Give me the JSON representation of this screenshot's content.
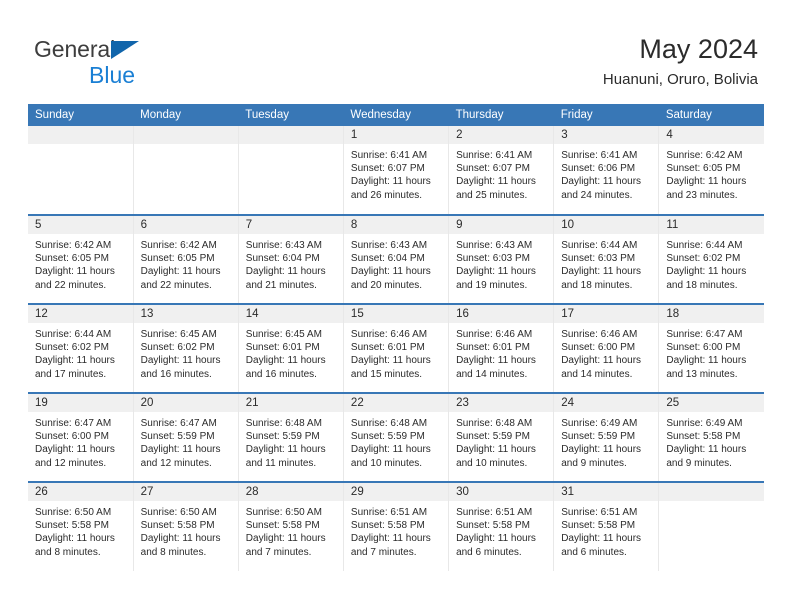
{
  "brand": {
    "name_top": "General",
    "name_bottom": "Blue",
    "triangle_color": "#1165ab",
    "blue_color": "#1a7fd4"
  },
  "header": {
    "title": "May 2024",
    "subtitle": "Huanuni, Oruro, Bolivia"
  },
  "theme": {
    "header_blue": "#3877b6",
    "daynum_band": "#f0f0f0",
    "text": "#2b2b2b"
  },
  "columns": [
    "Sunday",
    "Monday",
    "Tuesday",
    "Wednesday",
    "Thursday",
    "Friday",
    "Saturday"
  ],
  "weeks": [
    [
      {
        "day": "",
        "lines": []
      },
      {
        "day": "",
        "lines": []
      },
      {
        "day": "",
        "lines": []
      },
      {
        "day": "1",
        "lines": [
          "Sunrise: 6:41 AM",
          "Sunset: 6:07 PM",
          "Daylight: 11 hours",
          "and 26 minutes."
        ]
      },
      {
        "day": "2",
        "lines": [
          "Sunrise: 6:41 AM",
          "Sunset: 6:07 PM",
          "Daylight: 11 hours",
          "and 25 minutes."
        ]
      },
      {
        "day": "3",
        "lines": [
          "Sunrise: 6:41 AM",
          "Sunset: 6:06 PM",
          "Daylight: 11 hours",
          "and 24 minutes."
        ]
      },
      {
        "day": "4",
        "lines": [
          "Sunrise: 6:42 AM",
          "Sunset: 6:05 PM",
          "Daylight: 11 hours",
          "and 23 minutes."
        ]
      }
    ],
    [
      {
        "day": "5",
        "lines": [
          "Sunrise: 6:42 AM",
          "Sunset: 6:05 PM",
          "Daylight: 11 hours",
          "and 22 minutes."
        ]
      },
      {
        "day": "6",
        "lines": [
          "Sunrise: 6:42 AM",
          "Sunset: 6:05 PM",
          "Daylight: 11 hours",
          "and 22 minutes."
        ]
      },
      {
        "day": "7",
        "lines": [
          "Sunrise: 6:43 AM",
          "Sunset: 6:04 PM",
          "Daylight: 11 hours",
          "and 21 minutes."
        ]
      },
      {
        "day": "8",
        "lines": [
          "Sunrise: 6:43 AM",
          "Sunset: 6:04 PM",
          "Daylight: 11 hours",
          "and 20 minutes."
        ]
      },
      {
        "day": "9",
        "lines": [
          "Sunrise: 6:43 AM",
          "Sunset: 6:03 PM",
          "Daylight: 11 hours",
          "and 19 minutes."
        ]
      },
      {
        "day": "10",
        "lines": [
          "Sunrise: 6:44 AM",
          "Sunset: 6:03 PM",
          "Daylight: 11 hours",
          "and 18 minutes."
        ]
      },
      {
        "day": "11",
        "lines": [
          "Sunrise: 6:44 AM",
          "Sunset: 6:02 PM",
          "Daylight: 11 hours",
          "and 18 minutes."
        ]
      }
    ],
    [
      {
        "day": "12",
        "lines": [
          "Sunrise: 6:44 AM",
          "Sunset: 6:02 PM",
          "Daylight: 11 hours",
          "and 17 minutes."
        ]
      },
      {
        "day": "13",
        "lines": [
          "Sunrise: 6:45 AM",
          "Sunset: 6:02 PM",
          "Daylight: 11 hours",
          "and 16 minutes."
        ]
      },
      {
        "day": "14",
        "lines": [
          "Sunrise: 6:45 AM",
          "Sunset: 6:01 PM",
          "Daylight: 11 hours",
          "and 16 minutes."
        ]
      },
      {
        "day": "15",
        "lines": [
          "Sunrise: 6:46 AM",
          "Sunset: 6:01 PM",
          "Daylight: 11 hours",
          "and 15 minutes."
        ]
      },
      {
        "day": "16",
        "lines": [
          "Sunrise: 6:46 AM",
          "Sunset: 6:01 PM",
          "Daylight: 11 hours",
          "and 14 minutes."
        ]
      },
      {
        "day": "17",
        "lines": [
          "Sunrise: 6:46 AM",
          "Sunset: 6:00 PM",
          "Daylight: 11 hours",
          "and 14 minutes."
        ]
      },
      {
        "day": "18",
        "lines": [
          "Sunrise: 6:47 AM",
          "Sunset: 6:00 PM",
          "Daylight: 11 hours",
          "and 13 minutes."
        ]
      }
    ],
    [
      {
        "day": "19",
        "lines": [
          "Sunrise: 6:47 AM",
          "Sunset: 6:00 PM",
          "Daylight: 11 hours",
          "and 12 minutes."
        ]
      },
      {
        "day": "20",
        "lines": [
          "Sunrise: 6:47 AM",
          "Sunset: 5:59 PM",
          "Daylight: 11 hours",
          "and 12 minutes."
        ]
      },
      {
        "day": "21",
        "lines": [
          "Sunrise: 6:48 AM",
          "Sunset: 5:59 PM",
          "Daylight: 11 hours",
          "and 11 minutes."
        ]
      },
      {
        "day": "22",
        "lines": [
          "Sunrise: 6:48 AM",
          "Sunset: 5:59 PM",
          "Daylight: 11 hours",
          "and 10 minutes."
        ]
      },
      {
        "day": "23",
        "lines": [
          "Sunrise: 6:48 AM",
          "Sunset: 5:59 PM",
          "Daylight: 11 hours",
          "and 10 minutes."
        ]
      },
      {
        "day": "24",
        "lines": [
          "Sunrise: 6:49 AM",
          "Sunset: 5:59 PM",
          "Daylight: 11 hours",
          "and 9 minutes."
        ]
      },
      {
        "day": "25",
        "lines": [
          "Sunrise: 6:49 AM",
          "Sunset: 5:58 PM",
          "Daylight: 11 hours",
          "and 9 minutes."
        ]
      }
    ],
    [
      {
        "day": "26",
        "lines": [
          "Sunrise: 6:50 AM",
          "Sunset: 5:58 PM",
          "Daylight: 11 hours",
          "and 8 minutes."
        ]
      },
      {
        "day": "27",
        "lines": [
          "Sunrise: 6:50 AM",
          "Sunset: 5:58 PM",
          "Daylight: 11 hours",
          "and 8 minutes."
        ]
      },
      {
        "day": "28",
        "lines": [
          "Sunrise: 6:50 AM",
          "Sunset: 5:58 PM",
          "Daylight: 11 hours",
          "and 7 minutes."
        ]
      },
      {
        "day": "29",
        "lines": [
          "Sunrise: 6:51 AM",
          "Sunset: 5:58 PM",
          "Daylight: 11 hours",
          "and 7 minutes."
        ]
      },
      {
        "day": "30",
        "lines": [
          "Sunrise: 6:51 AM",
          "Sunset: 5:58 PM",
          "Daylight: 11 hours",
          "and 6 minutes."
        ]
      },
      {
        "day": "31",
        "lines": [
          "Sunrise: 6:51 AM",
          "Sunset: 5:58 PM",
          "Daylight: 11 hours",
          "and 6 minutes."
        ]
      },
      {
        "day": "",
        "lines": []
      }
    ]
  ]
}
